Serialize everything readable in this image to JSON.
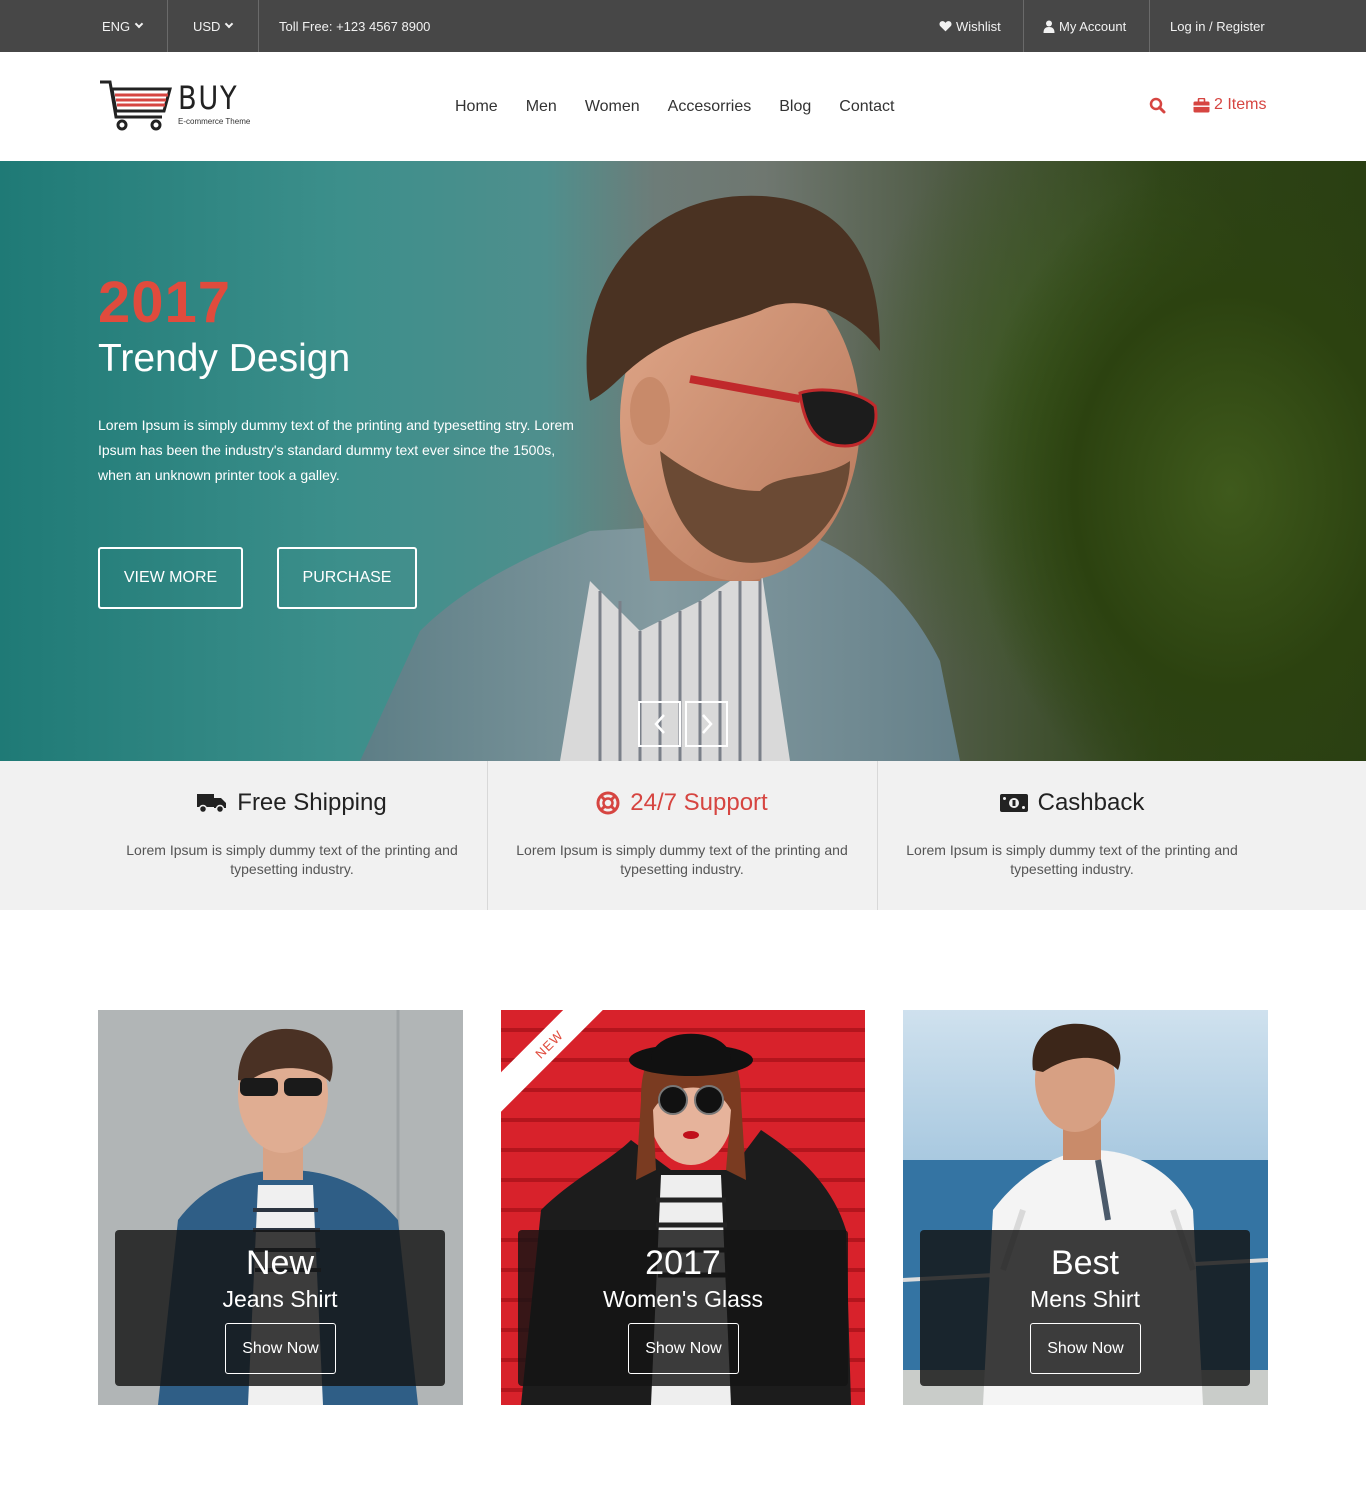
{
  "topbar": {
    "language": "ENG",
    "currency": "USD",
    "toll_free": "Toll Free: +123 4567 8900",
    "wishlist": "Wishlist",
    "my_account": "My Account",
    "login_register": "Log in / Register"
  },
  "brand": {
    "name": "BUY",
    "tagline": "E-commerce Theme",
    "accent_color": "#d64541"
  },
  "nav": {
    "items": [
      "Home",
      "Men",
      "Women",
      "Accesorries",
      "Blog",
      "Contact"
    ]
  },
  "cart": {
    "label": "2 Items"
  },
  "hero": {
    "year": "2017",
    "title": "Trendy Design",
    "text": "Lorem Ipsum is simply dummy text of the printing and typesetting stry. Lorem Ipsum has been the industry's standard dummy text ever since the 1500s, when an unknown printer took a galley.",
    "view_more": "VIEW MORE",
    "purchase": "PURCHASE"
  },
  "features": [
    {
      "title": "Free Shipping",
      "icon": "truck-icon",
      "text": "Lorem Ipsum is simply dummy text of the printing and typesetting industry."
    },
    {
      "title": "24/7 Support",
      "icon": "lifebuoy-icon",
      "text": "Lorem Ipsum is simply dummy text of the printing and typesetting industry."
    },
    {
      "title": "Cashback",
      "icon": "money-icon",
      "text": "Lorem Ipsum is simply dummy text of the printing and typesetting industry."
    }
  ],
  "cards": [
    {
      "line1": "New",
      "line2": "Jeans Shirt",
      "button": "Show Now"
    },
    {
      "line1": "2017",
      "line2": "Women's Glass",
      "button": "Show Now",
      "ribbon": "NEW"
    },
    {
      "line1": "Best",
      "line2": "Mens Shirt",
      "button": "Show Now"
    }
  ]
}
